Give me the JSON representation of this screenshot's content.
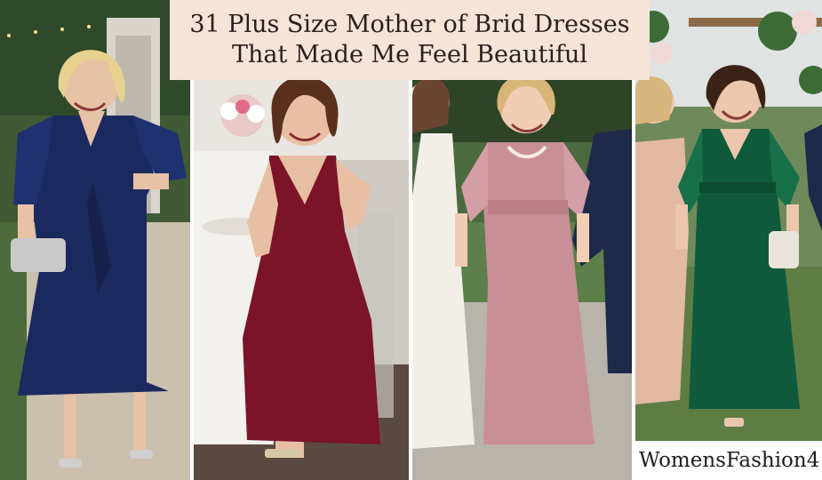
{
  "title": {
    "line1": "31 Plus Size Mother of Brid Dresses",
    "line2": "That Made Me Feel Beautiful"
  },
  "watermark": "WomensFashion4",
  "panels": [
    {
      "name": "navy-wrap-dress-photo",
      "dress_color": "#1b2a5e"
    },
    {
      "name": "burgundy-sequin-dress-photo",
      "dress_color": "#7a1426"
    },
    {
      "name": "mauve-chiffon-dress-photo",
      "dress_color": "#c98f98"
    },
    {
      "name": "emerald-gown-photo",
      "dress_color": "#0f5a3c"
    }
  ]
}
